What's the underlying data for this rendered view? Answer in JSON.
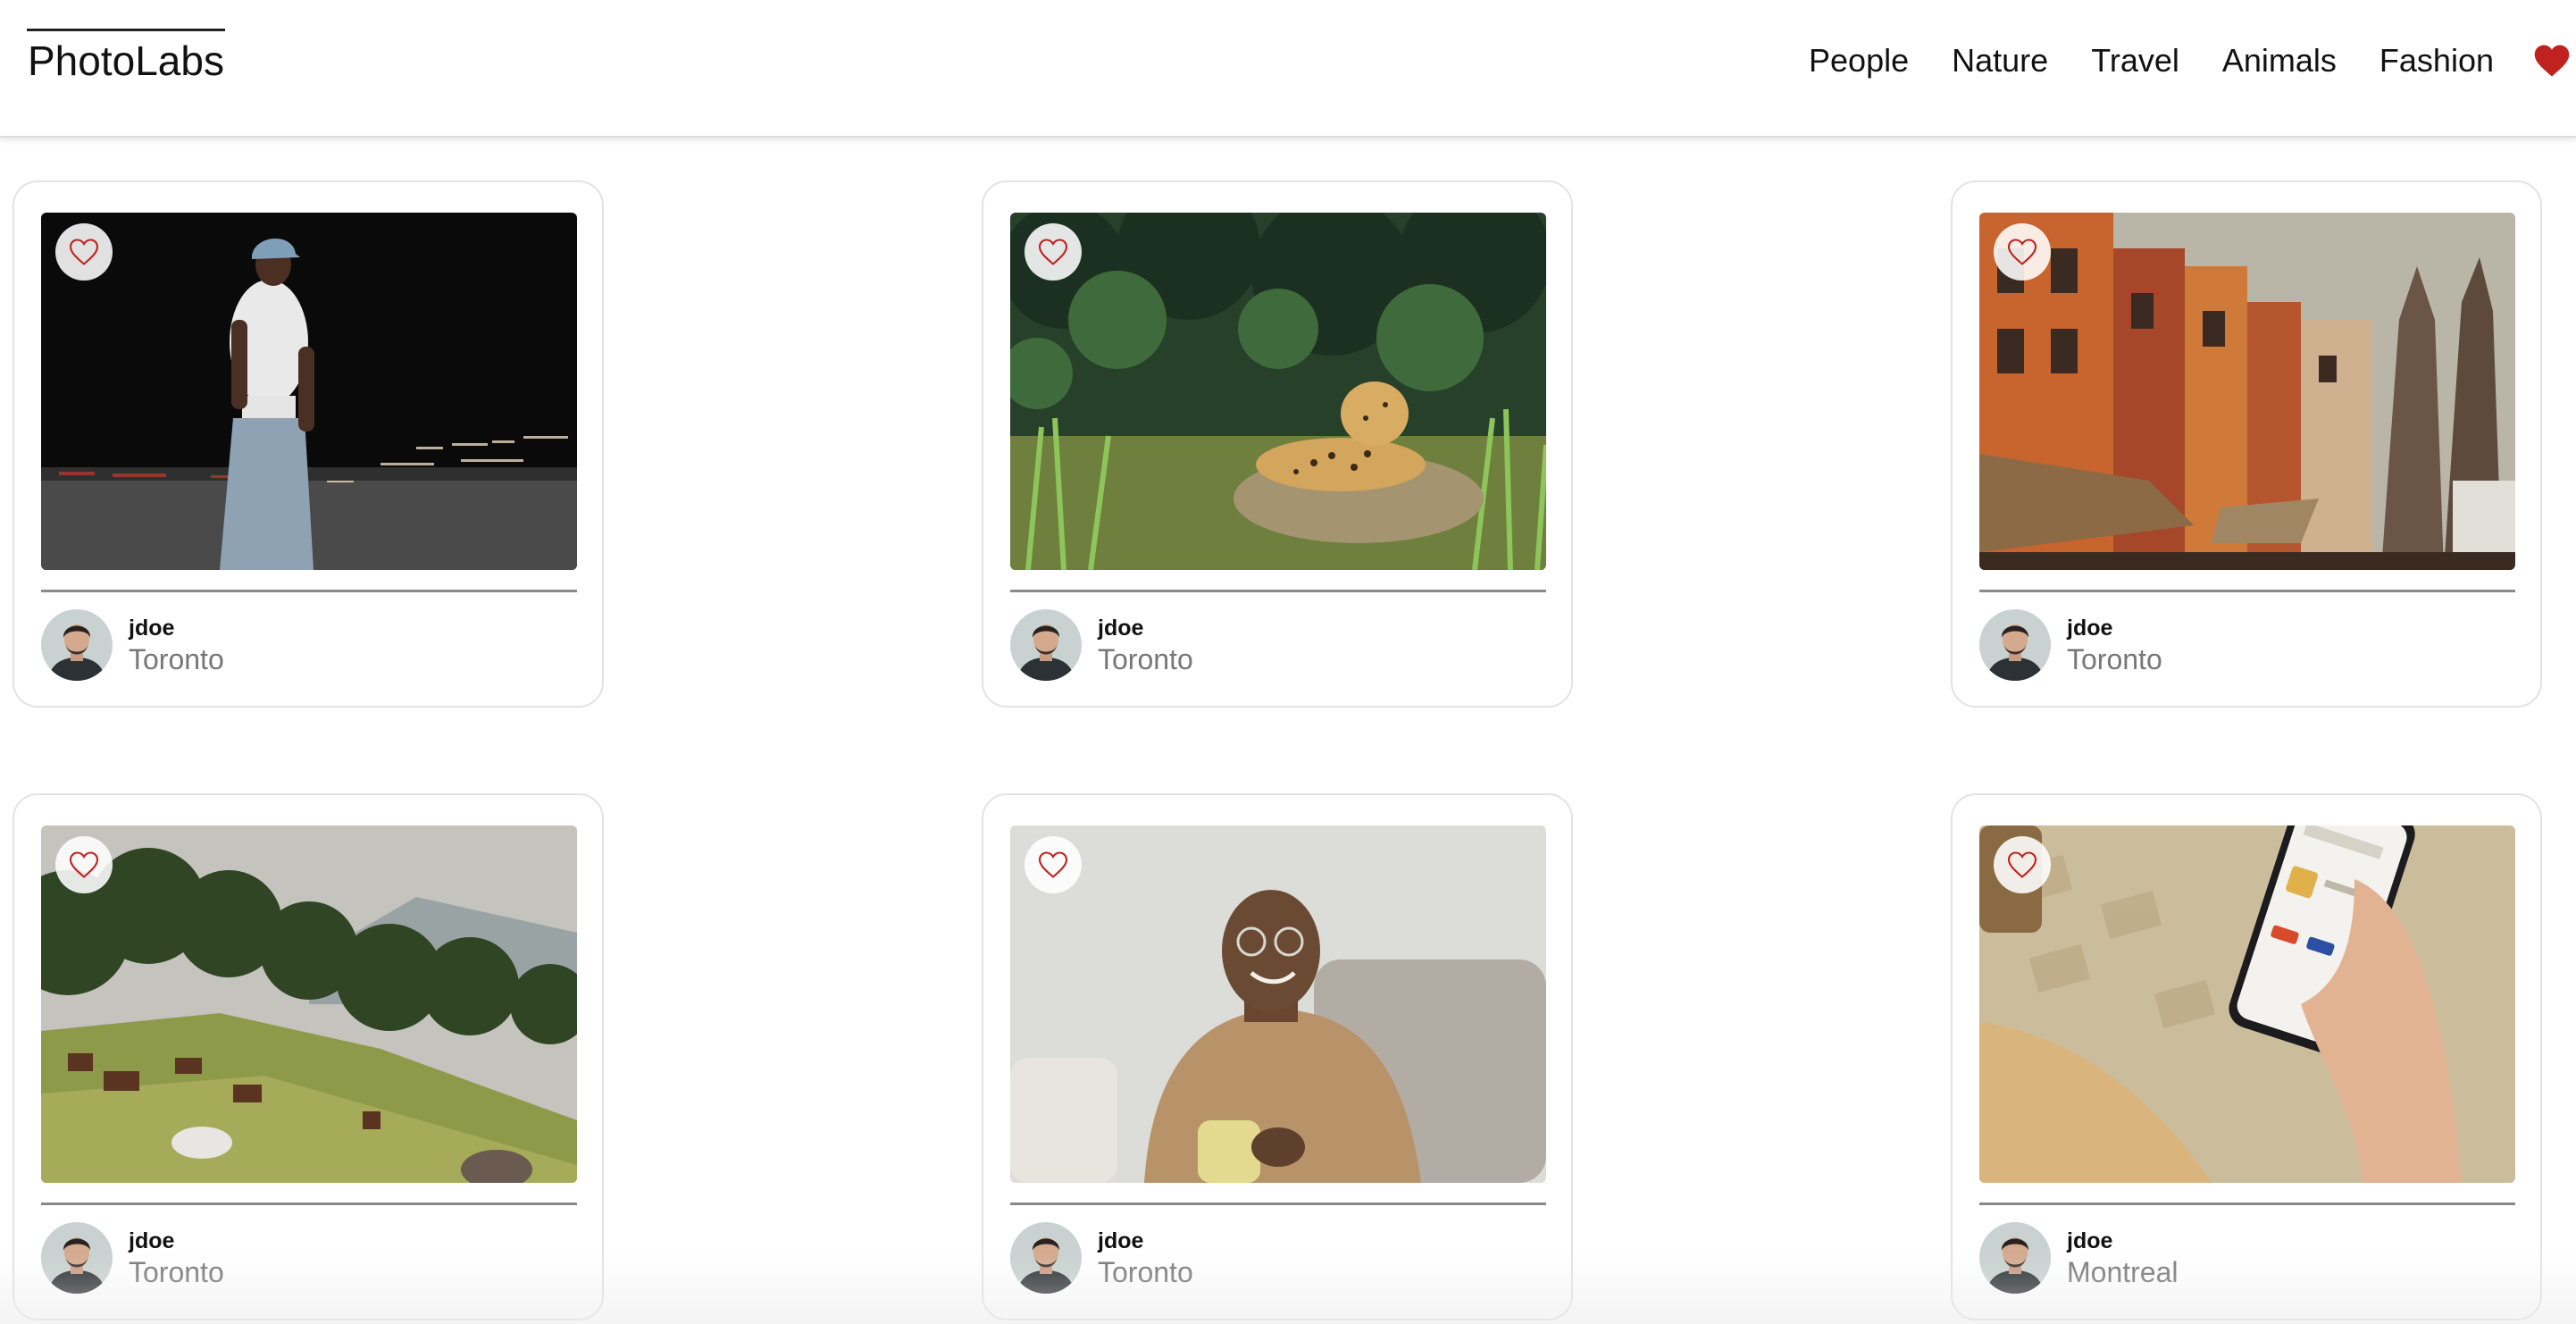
{
  "app": {
    "name": "PhotoLabs"
  },
  "nav": {
    "topics": [
      "People",
      "Nature",
      "Travel",
      "Animals",
      "Fashion"
    ],
    "favourites_icon": "heart-filled-icon",
    "favourites_color": "#C0221F"
  },
  "photos": [
    {
      "subject": "man-in-cap-night-street",
      "user": {
        "username": "jdoe",
        "location": "Toronto"
      }
    },
    {
      "subject": "jaguar-in-grass",
      "user": {
        "username": "jdoe",
        "location": "Toronto"
      }
    },
    {
      "subject": "orange-buildings-street",
      "user": {
        "username": "jdoe",
        "location": "Toronto"
      }
    },
    {
      "subject": "horses-grazing-hillside",
      "user": {
        "username": "jdoe",
        "location": "Toronto"
      }
    },
    {
      "subject": "smiling-man-with-mug",
      "user": {
        "username": "jdoe",
        "location": "Toronto"
      }
    },
    {
      "subject": "hand-holding-phone",
      "user": {
        "username": "jdoe",
        "location": "Montreal"
      }
    }
  ],
  "like_icon": "heart-outline-icon",
  "like_color": "#C0221F"
}
